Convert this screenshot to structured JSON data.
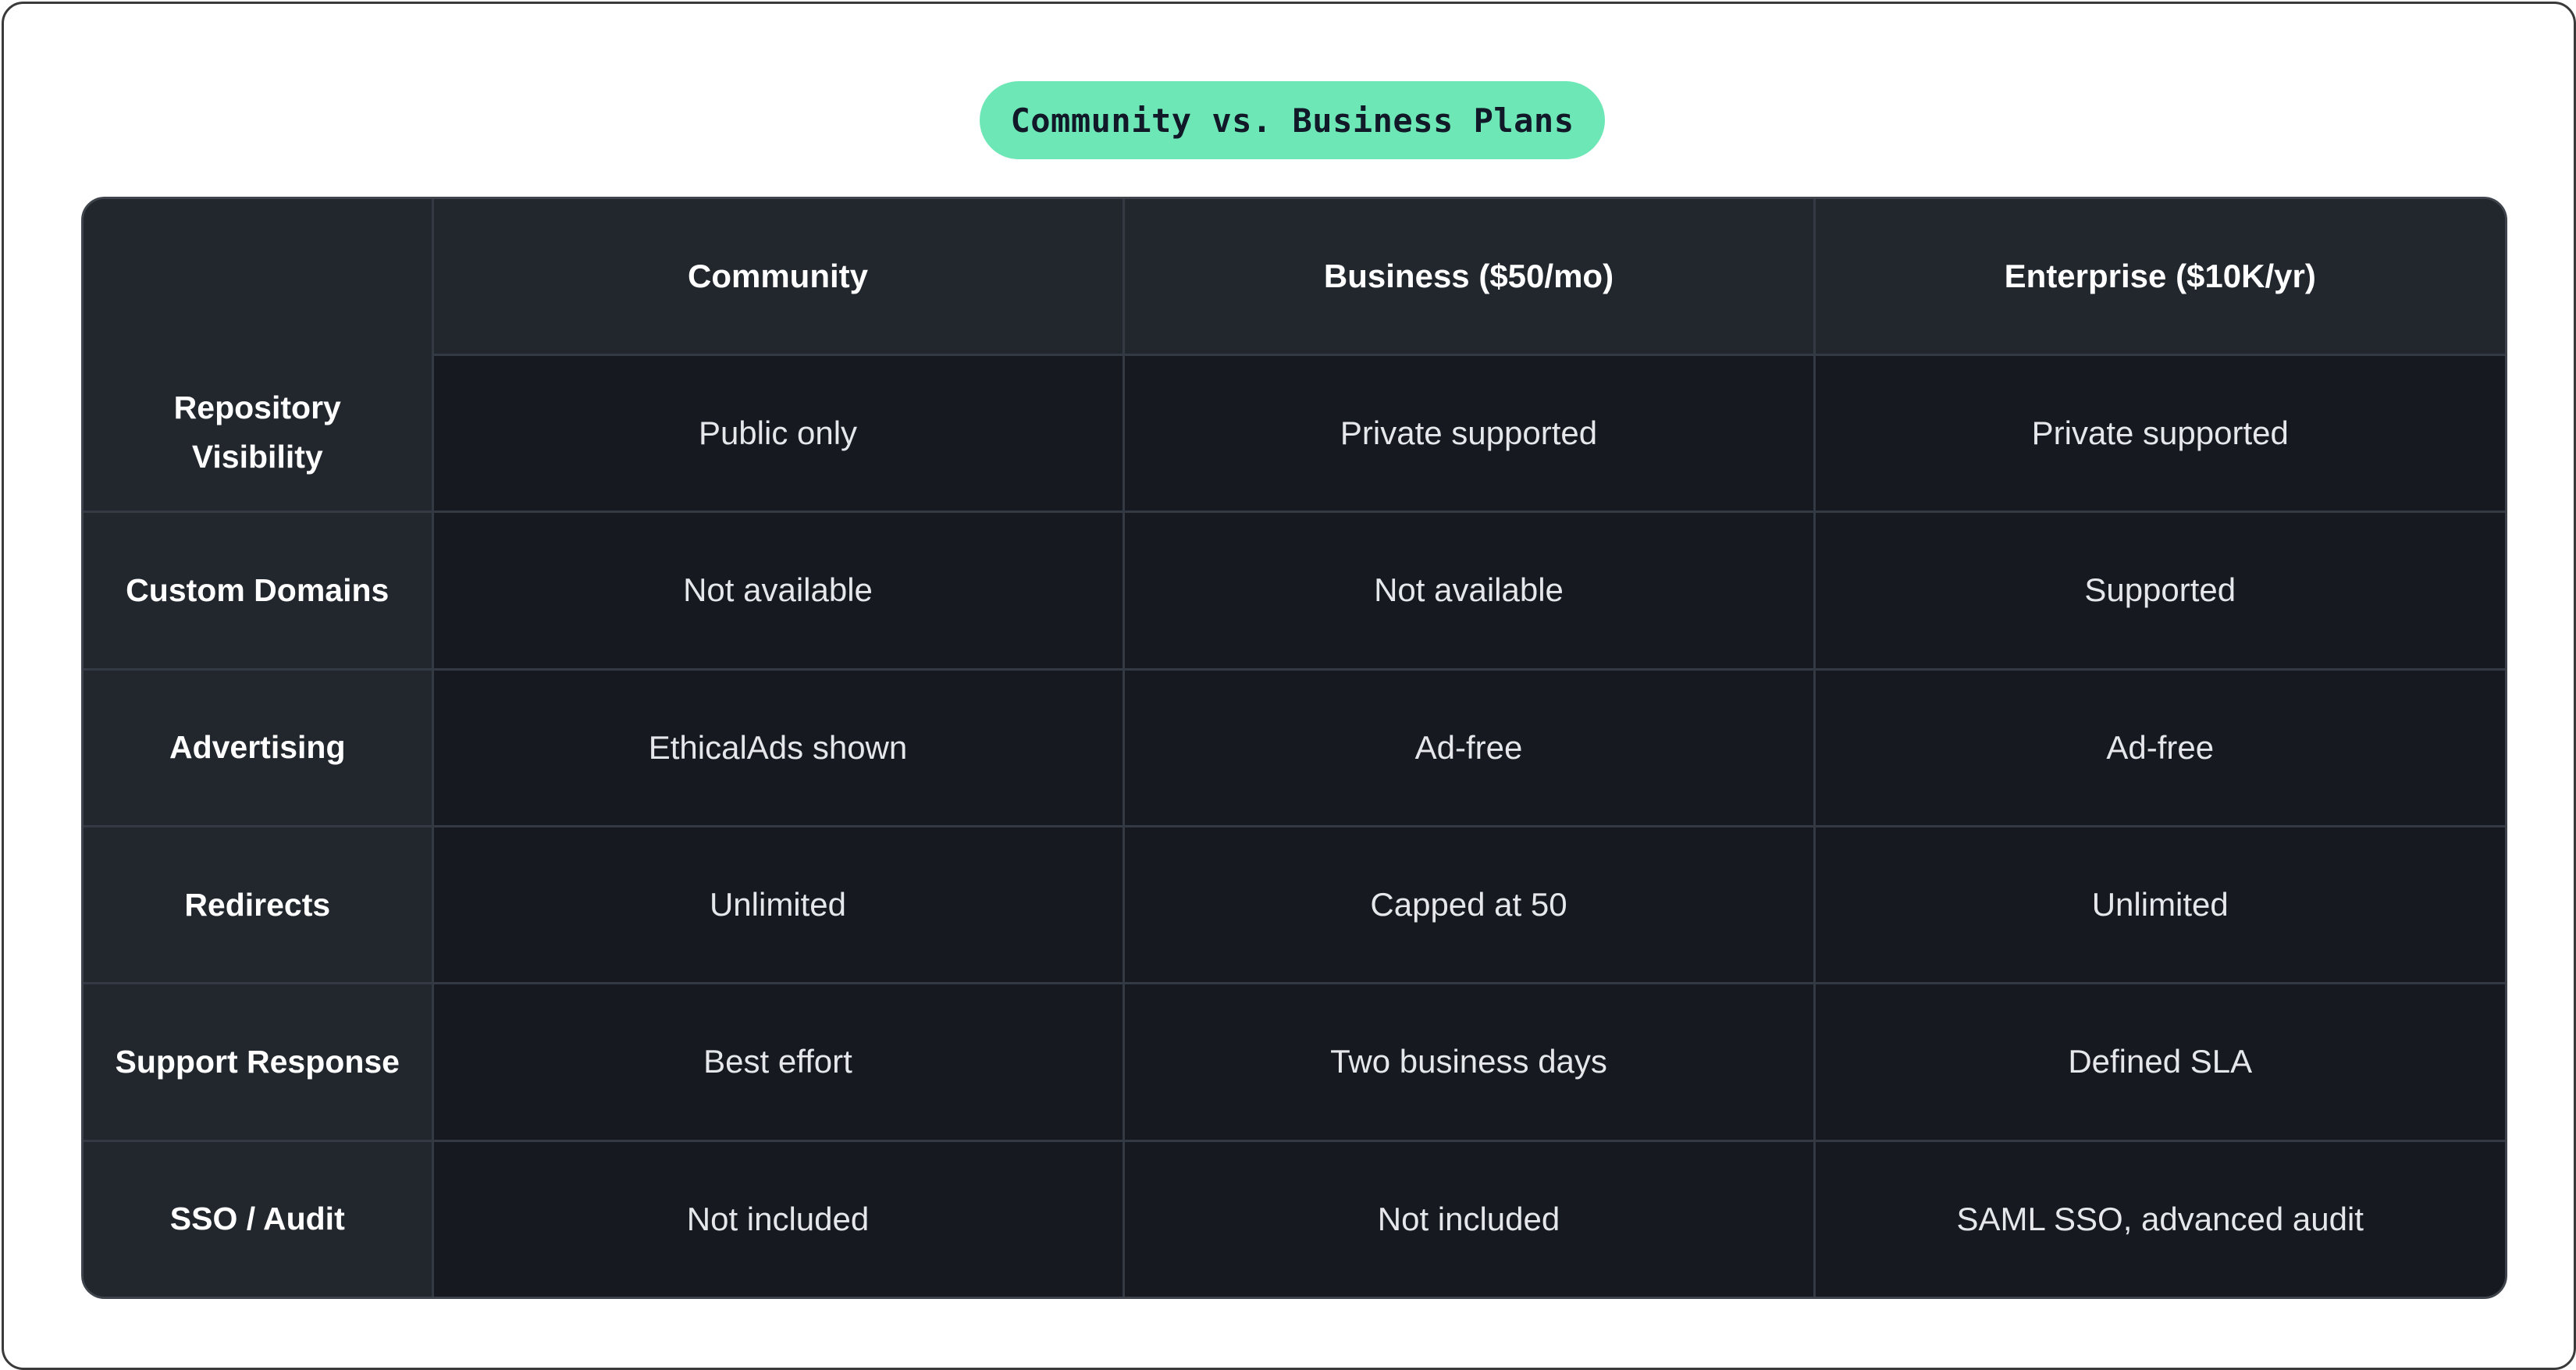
{
  "title": "Community vs. Business Plans",
  "table": {
    "columns": [
      "",
      "Community",
      "Business ($50/mo)",
      "Enterprise ($10K/yr)"
    ],
    "rows": [
      {
        "feature": "Repository Visibility",
        "values": [
          "Public only",
          "Private supported",
          "Private supported"
        ]
      },
      {
        "feature": "Custom Domains",
        "values": [
          "Not available",
          "Not available",
          "Supported"
        ]
      },
      {
        "feature": "Advertising",
        "values": [
          "EthicalAds shown",
          "Ad-free",
          "Ad-free"
        ]
      },
      {
        "feature": "Redirects",
        "values": [
          "Unlimited",
          "Capped at 50",
          "Unlimited"
        ]
      },
      {
        "feature": "Support Response",
        "values": [
          "Best effort",
          "Two business days",
          "Defined SLA"
        ]
      },
      {
        "feature": "SSO / Audit",
        "values": [
          "Not included",
          "Not included",
          "SAML SSO, advanced audit"
        ]
      }
    ]
  },
  "colors": {
    "title_pill": "#6ee7b7",
    "header_bg": "#22272e",
    "cell_bg": "#161a20",
    "border": "#343a43"
  }
}
